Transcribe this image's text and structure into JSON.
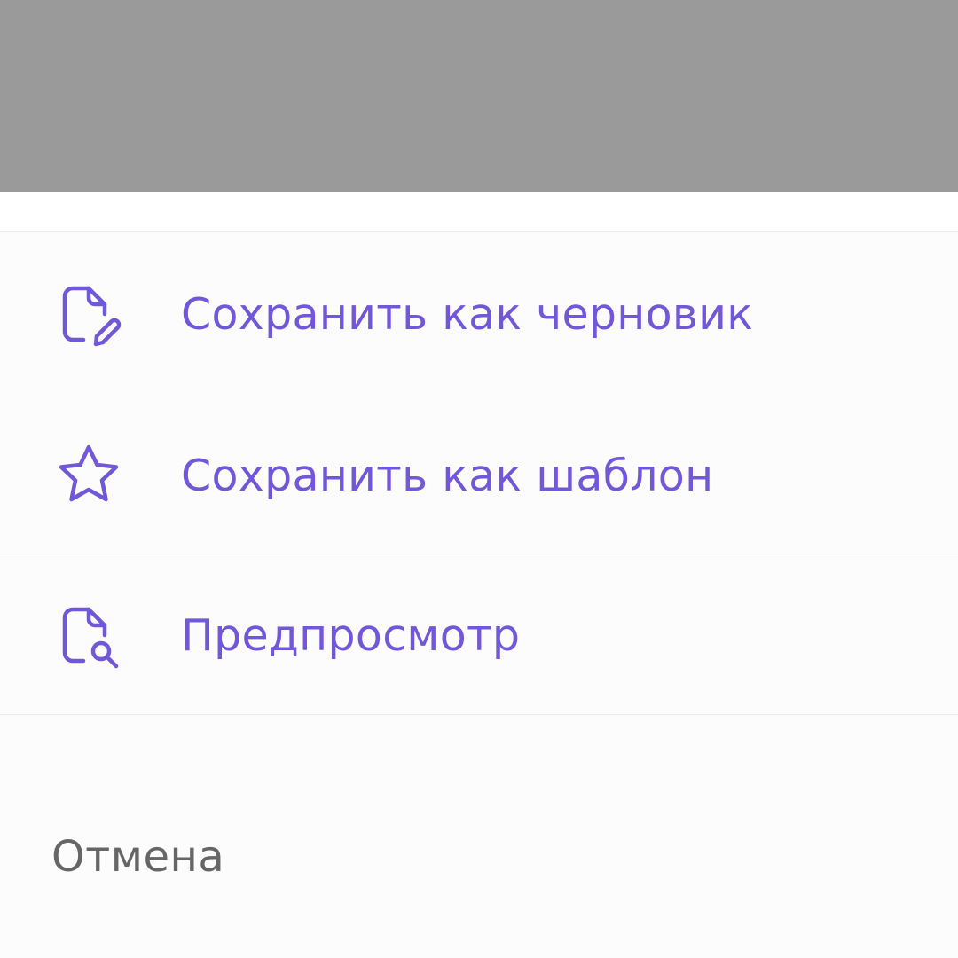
{
  "colors": {
    "accent": "#7158d8",
    "cancel_text": "#666666",
    "overlay": "#9a9a9a",
    "sheet_background": "#fcfcfd",
    "divider": "#ececf0"
  },
  "menu": {
    "items": [
      {
        "label": "Сохранить как черновик",
        "icon": "file-edit-icon"
      },
      {
        "label": "Сохранить как шаблон",
        "icon": "star-icon"
      },
      {
        "label": "Предпросмотр",
        "icon": "file-search-icon"
      }
    ]
  },
  "cancel": {
    "label": "Отмена"
  }
}
